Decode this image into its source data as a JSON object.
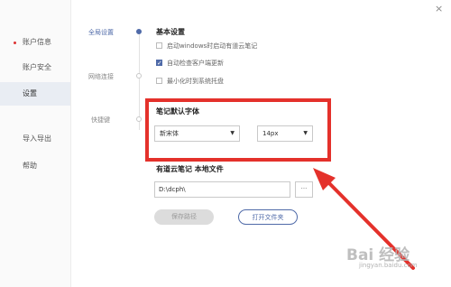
{
  "sidebar": {
    "items": [
      {
        "label": "账户信息"
      },
      {
        "label": "账户安全"
      },
      {
        "label": "设置"
      },
      {
        "label": "导入导出"
      },
      {
        "label": "帮助"
      }
    ]
  },
  "close_glyph": "×",
  "timeline": {
    "items": [
      {
        "label": "全局设置"
      },
      {
        "label": "网络连接"
      },
      {
        "label": "快捷键"
      }
    ]
  },
  "basic": {
    "title": "基本设置",
    "options": [
      {
        "label": "启动windows时启动有道云笔记",
        "checked": false
      },
      {
        "label": "自动检查客户端更新",
        "checked": true
      },
      {
        "label": "最小化时到系统托盘",
        "checked": false
      }
    ]
  },
  "font": {
    "title": "笔记默认字体",
    "family": "新宋体",
    "size": "14px",
    "caret": "▼"
  },
  "storage": {
    "title": "有道云笔记 本地文件",
    "path": "D:\\dcph\\",
    "more": "···",
    "save_label": "保存路径",
    "open_label": "打开文件夹"
  },
  "watermark": {
    "text": "Bai 经验",
    "sub": "jingyan.baidu.com"
  },
  "colors": {
    "accent": "#4f6aa8",
    "highlight": "#e4312b"
  }
}
